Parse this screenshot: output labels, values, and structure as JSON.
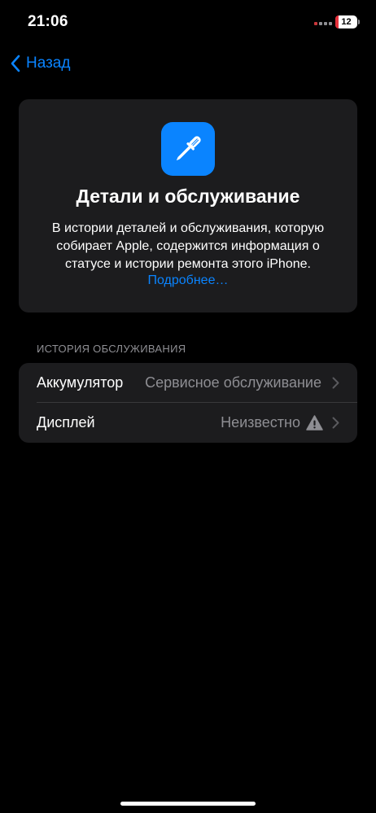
{
  "status_bar": {
    "time": "21:06",
    "battery_level": "12",
    "battery_color": "#e5303b"
  },
  "nav": {
    "back_label": "Назад",
    "back_icon": "chevron-left-icon"
  },
  "header_card": {
    "icon": "screwdriver-icon",
    "icon_bg": "#0a84ff",
    "title": "Детали и обслуживание",
    "description": "В истории деталей и обслуживания, которую собирает Apple, содержится информация о статусе и истории ремонта этого iPhone.",
    "link": "Подробнее…"
  },
  "service_history": {
    "section_title": "ИСТОРИЯ ОБСЛУЖИВАНИЯ",
    "rows": [
      {
        "label": "Аккумулятор",
        "value": "Сервисное обслуживание",
        "icon": "chevron-right-icon"
      },
      {
        "label": "Дисплей",
        "value": "Неизвестно",
        "status_icon": "warning-icon",
        "icon": "chevron-right-icon"
      }
    ]
  },
  "colors": {
    "accent": "#0a84ff",
    "background": "#000000",
    "card": "#1c1c1e",
    "secondary_text": "#8e8e93"
  }
}
